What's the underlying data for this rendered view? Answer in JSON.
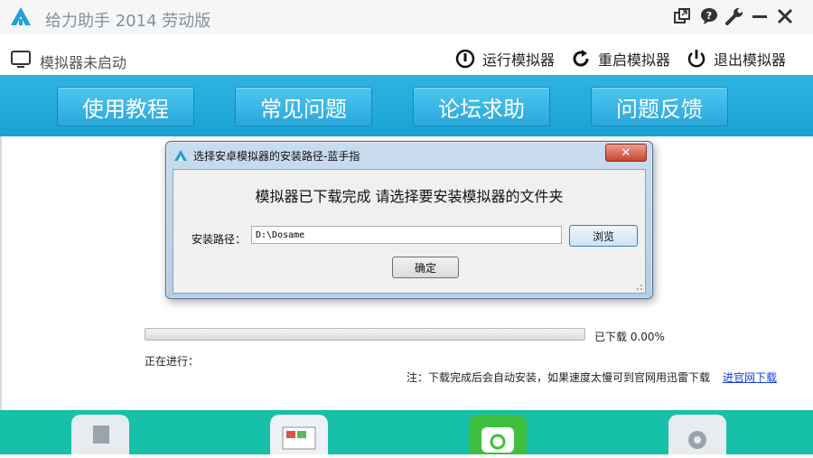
{
  "app": {
    "title": "给力助手 2014 劳动版"
  },
  "status": {
    "simulator_state": "模拟器未启动",
    "run_label": "运行模拟器",
    "restart_label": "重启模拟器",
    "exit_label": "退出模拟器"
  },
  "nav": {
    "items": [
      "使用教程",
      "常见问题",
      "论坛求助",
      "问题反馈"
    ]
  },
  "progress": {
    "downloaded_text": "已下载 0.00%",
    "percent": 0,
    "ongoing_label": "正在进行：",
    "note": "注：下载完成后会自动安装，如果速度太慢可到官网用迅雷下载",
    "site_link": "进官网下载"
  },
  "dialog": {
    "title": "选择安卓模拟器的安装路径-蓝手指",
    "message": "模拟器已下载完成 请选择要安装模拟器的文件夹",
    "path_label": "安装路径：",
    "path_value": "D:\\Dosame",
    "browse_label": "浏览",
    "ok_label": "确定"
  },
  "colors": {
    "nav_band": "#1aa1d4",
    "bottom_bar": "#17c0a8",
    "link": "#1a3fd6"
  },
  "icons": [
    "app-logo-icon",
    "restore-icon",
    "feedback-icon",
    "settings-wrench-icon",
    "minimize-icon",
    "close-icon",
    "monitor-icon",
    "run-icon",
    "restart-icon",
    "power-icon"
  ]
}
